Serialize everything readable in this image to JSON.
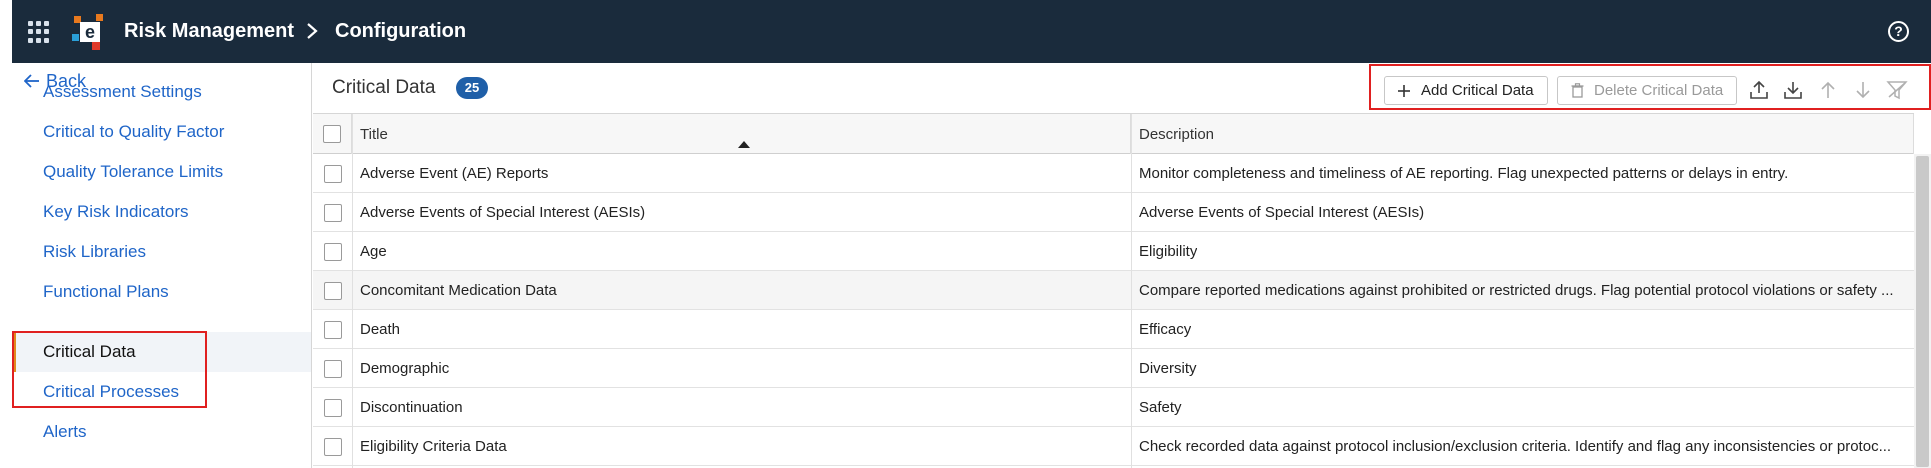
{
  "header": {
    "app_title": "Risk Management",
    "breadcrumb": "Configuration",
    "logo_letter": "e",
    "help_symbol": "?"
  },
  "sidebar": {
    "back_label": "Back",
    "items": [
      {
        "label": "Assessment Settings",
        "active": false
      },
      {
        "label": "Critical to Quality Factor",
        "active": false
      },
      {
        "label": "Quality Tolerance Limits",
        "active": false
      },
      {
        "label": "Key Risk Indicators",
        "active": false
      },
      {
        "label": "Risk Libraries",
        "active": false
      },
      {
        "label": "Functional Plans",
        "active": false
      },
      {
        "label": "Critical Data",
        "active": true
      },
      {
        "label": "Critical Processes",
        "active": false
      },
      {
        "label": "Alerts",
        "active": false
      }
    ]
  },
  "main": {
    "title": "Critical Data",
    "count": "25",
    "toolbar": {
      "add_label": "Add Critical Data",
      "delete_label": "Delete Critical Data",
      "icons": [
        "upload-icon",
        "download-icon",
        "move-up-icon",
        "move-down-icon",
        "filter-clear-icon"
      ]
    },
    "table": {
      "columns": [
        "Title",
        "Description"
      ],
      "sort": {
        "column": "Title",
        "direction": "ascending"
      },
      "rows": [
        {
          "title": "Adverse Event (AE) Reports",
          "description": "Monitor completeness and timeliness of AE reporting. Flag unexpected patterns or delays in entry."
        },
        {
          "title": "Adverse Events of Special Interest (AESIs)",
          "description": "Adverse Events of Special Interest (AESIs)"
        },
        {
          "title": "Age",
          "description": "Eligibility"
        },
        {
          "title": "Concomitant Medication Data",
          "description": "Compare reported medications against prohibited or restricted drugs. Flag potential protocol violations or safety ..."
        },
        {
          "title": "Death",
          "description": "Efficacy"
        },
        {
          "title": "Demographic",
          "description": "Diversity"
        },
        {
          "title": "Discontinuation",
          "description": "Safety"
        },
        {
          "title": "Eligibility Criteria Data",
          "description": "Check recorded data against protocol inclusion/exclusion criteria. Identify and flag any inconsistencies or protoc..."
        }
      ]
    }
  },
  "colors": {
    "topbar": "#1a2b3c",
    "link": "#1f65c8",
    "badge": "#1f5fa8",
    "active_indicator": "#e08a1e",
    "highlight_box": "#e02020"
  }
}
